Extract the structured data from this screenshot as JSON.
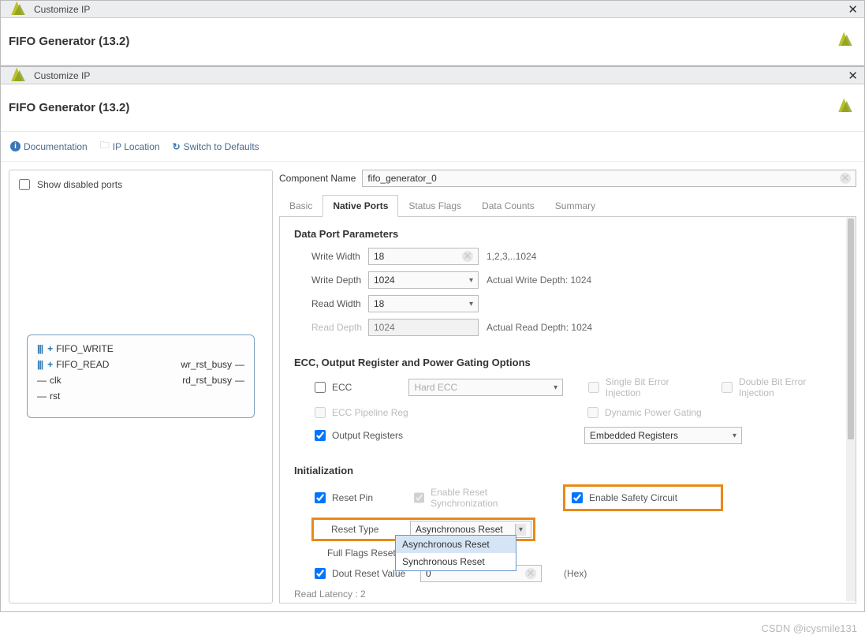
{
  "outer_window": {
    "title": "Customize IP"
  },
  "inner_window": {
    "title": "Customize IP"
  },
  "app": {
    "name": "FIFO Generator (13.2)"
  },
  "toolbar": {
    "doc": "Documentation",
    "loc": "IP Location",
    "switch": "Switch to Defaults"
  },
  "left": {
    "show_disabled": "Show disabled ports",
    "ports": {
      "fifo_write": "FIFO_WRITE",
      "fifo_read": "FIFO_READ",
      "clk": "clk",
      "rst": "rst",
      "wr_busy": "wr_rst_busy",
      "rd_busy": "rd_rst_busy"
    }
  },
  "comp": {
    "label": "Component Name",
    "value": "fifo_generator_0"
  },
  "tabs": {
    "basic": "Basic",
    "native": "Native Ports",
    "status": "Status Flags",
    "counts": "Data Counts",
    "summary": "Summary"
  },
  "sec_data": {
    "title": "Data Port Parameters",
    "write_width_lbl": "Write Width",
    "write_width_val": "18",
    "write_width_hint": "1,2,3,..1024",
    "write_depth_lbl": "Write Depth",
    "write_depth_val": "1024",
    "write_depth_hint": "Actual Write Depth: 1024",
    "read_width_lbl": "Read Width",
    "read_width_val": "18",
    "read_depth_lbl": "Read Depth",
    "read_depth_val": "1024",
    "read_depth_hint": "Actual Read Depth: 1024"
  },
  "sec_ecc": {
    "title": "ECC, Output Register and Power Gating Options",
    "ecc": "ECC",
    "hard_ecc": "Hard ECC",
    "sbe": "Single Bit Error Injection",
    "dbe": "Double Bit Error Injection",
    "pipeline": "ECC Pipeline Reg",
    "dynamic": "Dynamic Power Gating",
    "out_reg": "Output Registers",
    "emb_reg": "Embedded Registers"
  },
  "sec_init": {
    "title": "Initialization",
    "reset_pin": "Reset Pin",
    "enable_sync": "Enable Reset Synchronization",
    "safety": "Enable Safety Circuit",
    "reset_type": "Reset Type",
    "reset_type_val": "Asynchronous Reset",
    "dd_async": "Asynchronous Reset",
    "dd_sync": "Synchronous Reset",
    "full_flags": "Full Flags Reset Value",
    "dout_reset": "Dout Reset Value",
    "dout_val": "0",
    "hex": "(Hex)",
    "latency": "Read Latency : 2"
  },
  "watermark": "CSDN @icysmile131"
}
